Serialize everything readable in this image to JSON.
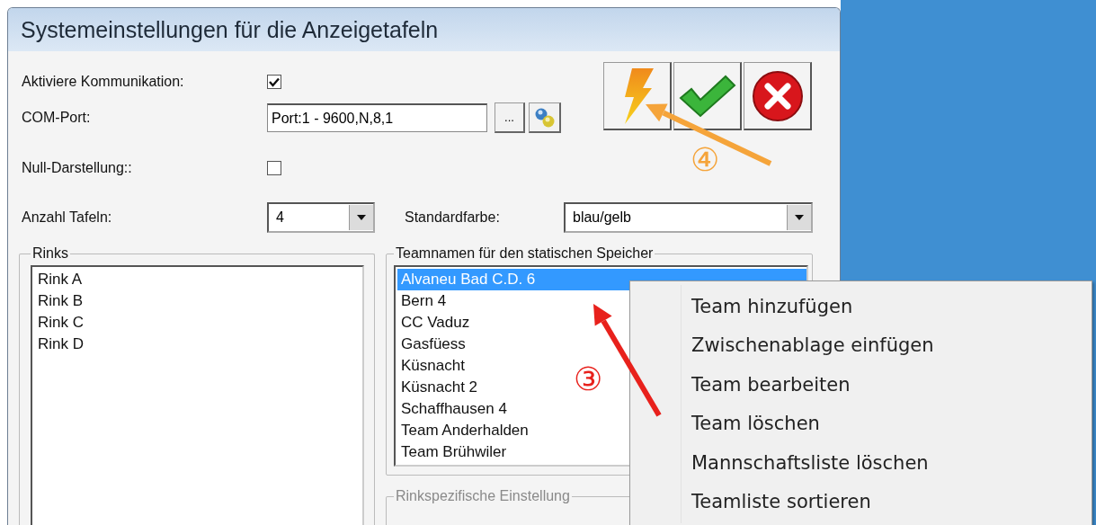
{
  "window": {
    "title": "Systemeinstellungen für die Anzeigetafeln"
  },
  "settings": [
    {
      "kind": "checkbox",
      "label": "Aktiviere Kommunikation:",
      "checked": true
    },
    {
      "kind": "port",
      "label": "COM-Port:",
      "value": "Port:1 - 9600,N,8,1",
      "browse": "..."
    },
    {
      "kind": "checkbox",
      "label": "Null-Darstellung::",
      "checked": false
    }
  ],
  "boards": {
    "label": "Anzahl Tafeln:",
    "value": "4"
  },
  "default_color": {
    "label": "Standardfarbe:",
    "value": "blau/gelb"
  },
  "rinks": {
    "title": "Rinks",
    "items": [
      {
        "label": "Rink A",
        "selected": false
      },
      {
        "label": "Rink B",
        "selected": false
      },
      {
        "label": "Rink C",
        "selected": false
      },
      {
        "label": "Rink D",
        "selected": false
      }
    ]
  },
  "teams": {
    "title": "Teamnamen für den statischen Speicher",
    "items": [
      {
        "label": "Alvaneu Bad C.D. 6",
        "selected": true
      },
      {
        "label": "Bern 4",
        "selected": false
      },
      {
        "label": "CC Vaduz",
        "selected": false
      },
      {
        "label": "Gasfüess",
        "selected": false
      },
      {
        "label": "Küsnacht",
        "selected": false
      },
      {
        "label": "Küsnacht 2",
        "selected": false
      },
      {
        "label": "Schaffhausen 4",
        "selected": false
      },
      {
        "label": "Team Anderhalden",
        "selected": false
      },
      {
        "label": "Team Brühwiler",
        "selected": false
      }
    ]
  },
  "rink_settings": {
    "title": "Rinkspezifische Einstellung",
    "disabled": true
  },
  "context_menu": [
    "Team hinzufügen",
    "Zwischenablage einfügen",
    "Team bearbeiten",
    "Team löschen",
    "Mannschaftsliste löschen",
    "Teamliste sortieren"
  ],
  "annotations": [
    {
      "label": "③",
      "color": "#e8211c"
    },
    {
      "label": "④",
      "color": "#f5a43a"
    }
  ]
}
